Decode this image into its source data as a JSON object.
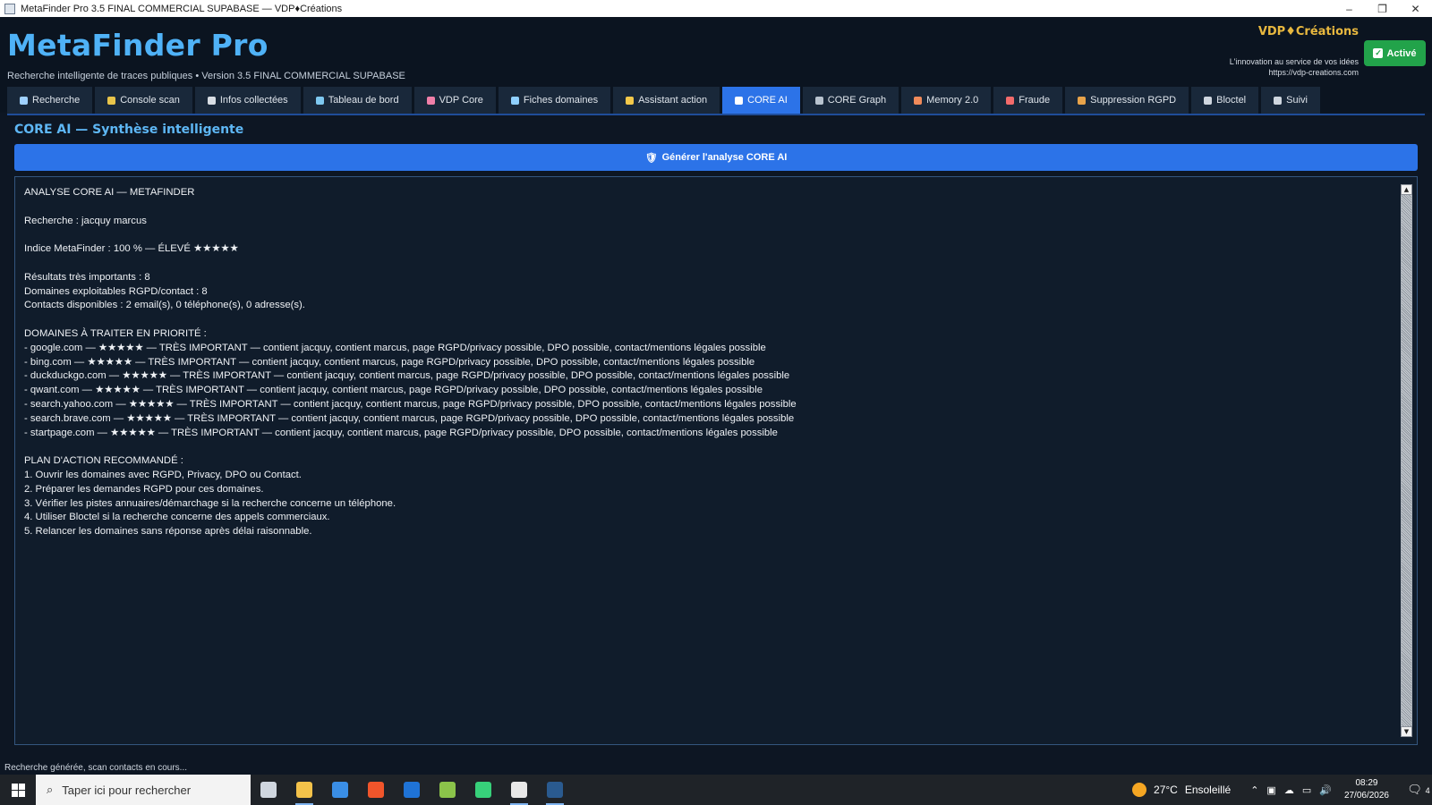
{
  "window": {
    "title": "MetaFinder Pro 3.5 FINAL COMMERCIAL SUPABASE — VDP♦Créations",
    "minimize": "–",
    "maximize": "❐",
    "close": "✕"
  },
  "header": {
    "brand": "MetaFinder Pro",
    "subtitle": "Recherche intelligente de traces publiques • Version 3.5 FINAL COMMERCIAL SUPABASE",
    "company": "VDP♦Créations",
    "tagline": "L'innovation au service de vos idées",
    "url": "https://vdp-creations.com",
    "status_button": "Activé",
    "status_color": "#22a34a",
    "brand_color": "#4fb2f7"
  },
  "tabs": [
    {
      "label": "Recherche",
      "icon": "search-icon",
      "color": "#9fd1ff"
    },
    {
      "label": "Console scan",
      "icon": "console-icon",
      "color": "#e8c44a"
    },
    {
      "label": "Infos collectées",
      "icon": "folder-icon",
      "color": "#d8dde4"
    },
    {
      "label": "Tableau de bord",
      "icon": "chart-icon",
      "color": "#7ec8f0"
    },
    {
      "label": "VDP Core",
      "icon": "brain-icon",
      "color": "#f07fa8"
    },
    {
      "label": "Fiches domaines",
      "icon": "card-icon",
      "color": "#8fd0ff"
    },
    {
      "label": "Assistant action",
      "icon": "bulb-icon",
      "color": "#f3c84a"
    },
    {
      "label": "CORE AI",
      "icon": "robot-icon",
      "color": "#ffffff",
      "active": true
    },
    {
      "label": "CORE Graph",
      "icon": "graph-icon",
      "color": "#b8c3cf"
    },
    {
      "label": "Memory 2.0",
      "icon": "memory-icon",
      "color": "#f08a5a"
    },
    {
      "label": "Fraude",
      "icon": "shield-icon",
      "color": "#f36b6b"
    },
    {
      "label": "Suppression RGPD",
      "icon": "broom-icon",
      "color": "#e8a34a"
    },
    {
      "label": "Bloctel",
      "icon": "phone-icon",
      "color": "#cfd6df"
    },
    {
      "label": "Suivi",
      "icon": "clipboard-icon",
      "color": "#cfd6df"
    }
  ],
  "main": {
    "section_title": "CORE AI — Synthèse intelligente",
    "generate_button": "Générer l'analyse CORE AI",
    "accent_color": "#2c73e8",
    "output_lines": [
      "ANALYSE CORE AI — METAFINDER",
      "",
      "Recherche : jacquy marcus",
      "",
      "Indice MetaFinder : 100 % — ÉLEVÉ ★★★★★",
      "",
      "Résultats très importants : 8",
      "Domaines exploitables RGPD/contact : 8",
      "Contacts disponibles : 2 email(s), 0 téléphone(s), 0 adresse(s).",
      "",
      "DOMAINES À TRAITER EN PRIORITÉ :",
      "- google.com — ★★★★★ — TRÈS IMPORTANT — contient jacquy, contient marcus, page RGPD/privacy possible, DPO possible, contact/mentions légales possible",
      "- bing.com — ★★★★★ — TRÈS IMPORTANT — contient jacquy, contient marcus, page RGPD/privacy possible, DPO possible, contact/mentions légales possible",
      "- duckduckgo.com — ★★★★★ — TRÈS IMPORTANT — contient jacquy, contient marcus, page RGPD/privacy possible, DPO possible, contact/mentions légales possible",
      "- qwant.com — ★★★★★ — TRÈS IMPORTANT — contient jacquy, contient marcus, page RGPD/privacy possible, DPO possible, contact/mentions légales possible",
      "- search.yahoo.com — ★★★★★ — TRÈS IMPORTANT — contient jacquy, contient marcus, page RGPD/privacy possible, DPO possible, contact/mentions légales possible",
      "- search.brave.com — ★★★★★ — TRÈS IMPORTANT — contient jacquy, contient marcus, page RGPD/privacy possible, DPO possible, contact/mentions légales possible",
      "- startpage.com — ★★★★★ — TRÈS IMPORTANT — contient jacquy, contient marcus, page RGPD/privacy possible, DPO possible, contact/mentions légales possible",
      "",
      "PLAN D'ACTION RECOMMANDÉ :",
      "1. Ouvrir les domaines avec RGPD, Privacy, DPO ou Contact.",
      "2. Préparer les demandes RGPD pour ces domaines.",
      "3. Vérifier les pistes annuaires/démarchage si la recherche concerne un téléphone.",
      "4. Utiliser Bloctel si la recherche concerne des appels commerciaux.",
      "5. Relancer les domaines sans réponse après délai raisonnable."
    ]
  },
  "status_bar": {
    "message": "Recherche générée, scan contacts en cours..."
  },
  "taskbar": {
    "search_placeholder": "Taper ici pour rechercher",
    "apps": [
      {
        "name": "task-view-icon",
        "color": "#cfd6df"
      },
      {
        "name": "file-explorer-icon",
        "color": "#f3c24a"
      },
      {
        "name": "store-icon",
        "color": "#3a8ee6"
      },
      {
        "name": "brave-icon",
        "color": "#f0552b"
      },
      {
        "name": "outlook-icon",
        "color": "#1f73d6"
      },
      {
        "name": "app-green-icon",
        "color": "#8bc34a"
      },
      {
        "name": "bolt-icon",
        "color": "#37d07a"
      },
      {
        "name": "chatgpt-icon",
        "color": "#e8e8e8"
      },
      {
        "name": "metafinder-icon",
        "color": "#2a5a8f"
      }
    ],
    "temperature": "27°C",
    "weather": "Ensoleillé",
    "time": "08:29",
    "date": "27/06/2026",
    "notification_count": "4"
  }
}
